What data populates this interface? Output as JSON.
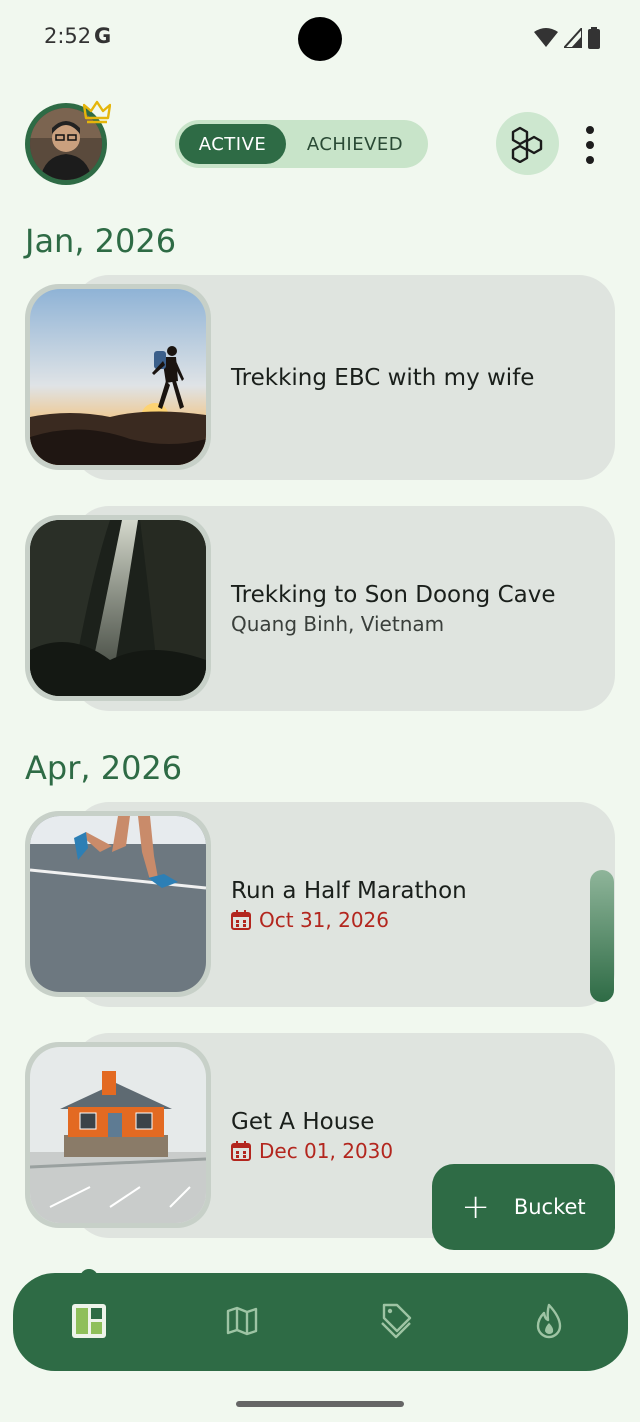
{
  "status_bar": {
    "time": "2:52",
    "g_label": "G"
  },
  "header": {
    "toggle": {
      "active_label": "ACTIVE",
      "inactive_label": "ACHIEVED"
    }
  },
  "sections": [
    {
      "title": "Jan, 2026",
      "items": [
        {
          "title": "Trekking EBC with my wife"
        },
        {
          "title": "Trekking to Son Doong Cave",
          "subtitle": "Quang Binh, Vietnam"
        }
      ]
    },
    {
      "title": "Apr, 2026",
      "items": [
        {
          "title": "Run a Half Marathon",
          "date": "Oct 31, 2026"
        },
        {
          "title": "Get A House",
          "date": "Dec 01, 2030"
        }
      ]
    }
  ],
  "fab": {
    "label": "Bucket",
    "icon": "plus-icon"
  },
  "nav": {
    "items": [
      {
        "icon": "dashboard-icon",
        "active": true
      },
      {
        "icon": "map-icon",
        "active": false
      },
      {
        "icon": "tag-icon",
        "active": false
      },
      {
        "icon": "flame-icon",
        "active": false
      }
    ]
  },
  "colors": {
    "primary": "#2e6b45",
    "background": "#f1f8ef",
    "card": "#dfe4df",
    "date_red": "#b3261e"
  }
}
